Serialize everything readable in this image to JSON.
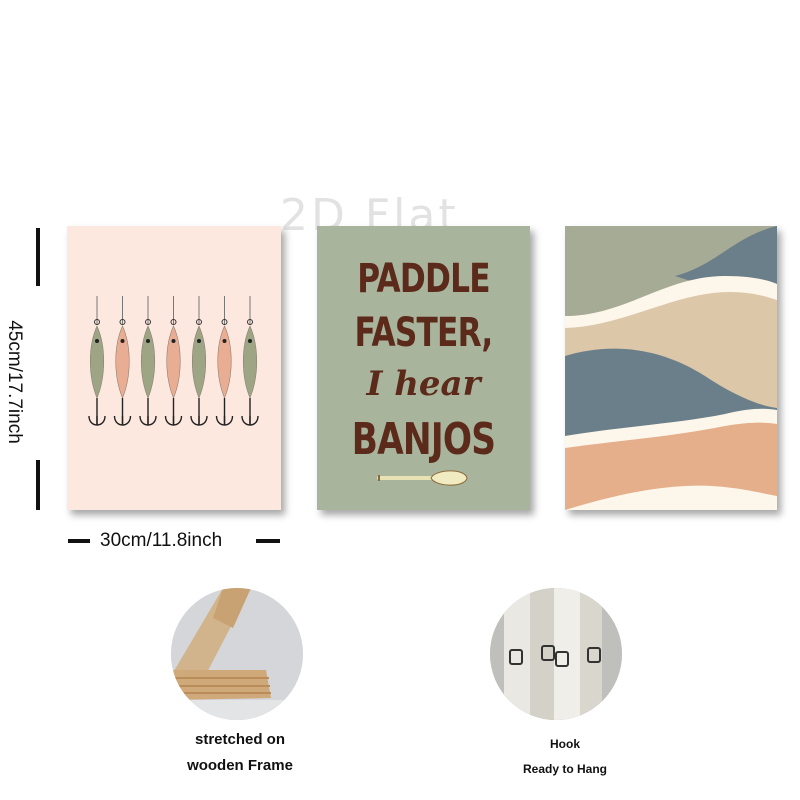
{
  "watermark": "2D Flat",
  "dimensions": {
    "height_label": "45cm/17.7inch",
    "width_label": "30cm/11.8inch"
  },
  "panels": [
    {
      "name": "fishing-lures-print",
      "lure_count": 7
    },
    {
      "name": "quote-print",
      "lines": [
        "PADDLE",
        "FASTER,",
        "I hear",
        "BANJOS"
      ],
      "icon": "paddle-icon"
    },
    {
      "name": "abstract-waves-print"
    }
  ],
  "features": [
    {
      "name": "wooden-frame",
      "lines": [
        "stretched on",
        "wooden Frame"
      ]
    },
    {
      "name": "hook",
      "lines": [
        "Hook",
        "Ready to Hang"
      ]
    }
  ],
  "colors": {
    "lure_bg": "#fde8df",
    "quote_bg": "#a9b49c",
    "quote_text": "#5b2a1a",
    "wave_slate": "#6b7f8a",
    "wave_sage": "#a6ab96",
    "wave_cream": "#fdf6ea",
    "wave_tan": "#dcc7a9",
    "wave_peach": "#e6af8c",
    "lure_sage": "#9da585",
    "lure_peach": "#e9ad94"
  }
}
